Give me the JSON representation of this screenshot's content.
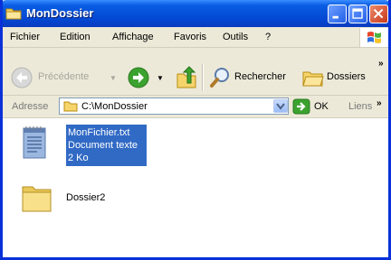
{
  "window": {
    "title": "MonDossier"
  },
  "menu": {
    "items": [
      "Fichier",
      "Edition",
      "Affichage",
      "Favoris",
      "Outils",
      "?"
    ]
  },
  "toolbar": {
    "back_label": "Précédente",
    "search_label": "Rechercher",
    "folders_label": "Dossiers",
    "overflow": "»"
  },
  "address": {
    "label": "Adresse",
    "value": "C:\\MonDossier",
    "go_label": "OK",
    "links_label": "Liens",
    "links_overflow": "»"
  },
  "files": [
    {
      "name": "MonFichier.txt",
      "type": "Document texte",
      "size": "2 Ko",
      "icon": "notepad-icon",
      "selected": true
    },
    {
      "name": "Dossier2",
      "icon": "folder-icon",
      "selected": false
    }
  ],
  "colors": {
    "title_bar": "#0348d3",
    "selection": "#316ac5",
    "chrome": "#ece9d8"
  }
}
